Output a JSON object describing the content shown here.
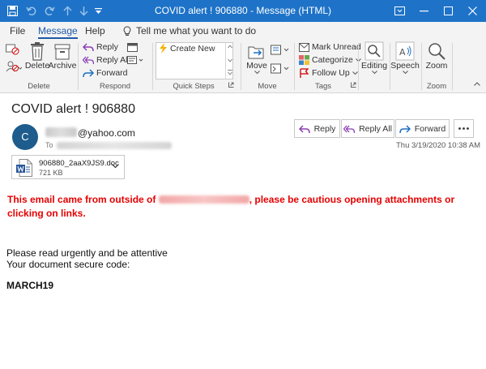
{
  "window": {
    "title": "COVID alert  ! 906880  -  Message (HTML)"
  },
  "tabs": [
    {
      "label": "File"
    },
    {
      "label": "Message"
    },
    {
      "label": "Help"
    }
  ],
  "tell_me": {
    "label": "Tell me what you want to do"
  },
  "ribbon": {
    "delete_group": {
      "label": "Delete",
      "delete": "Delete",
      "archive": "Archive"
    },
    "respond_group": {
      "label": "Respond",
      "reply": "Reply",
      "reply_all": "Reply All",
      "forward": "Forward"
    },
    "quick_steps_group": {
      "label": "Quick Steps",
      "create_new": "Create New"
    },
    "move_group": {
      "label": "Move",
      "move": "Move"
    },
    "tags_group": {
      "label": "Tags",
      "mark_unread": "Mark Unread",
      "categorize": "Categorize",
      "follow_up": "Follow Up"
    },
    "editing": "Editing",
    "speech": "Speech",
    "zoom_group": {
      "label": "Zoom",
      "zoom": "Zoom"
    }
  },
  "message": {
    "subject": "COVID alert  ! 906880",
    "avatar_initial": "C",
    "sender_domain": "@yahoo.com",
    "to_label": "To",
    "date": "Thu 3/19/2020 10:38 AM",
    "actions": {
      "reply": "Reply",
      "reply_all": "Reply All",
      "forward": "Forward"
    },
    "attachment": {
      "name": "906880_2aaX9JS9.doc",
      "size": "721 KB"
    },
    "warning": {
      "before": "This email came from outside of ",
      "after": ", please be cautious opening attachments or clicking on links."
    },
    "body_lines": [
      "Please read urgently and be attentive",
      "Your document secure code:"
    ],
    "code": "MARCH19"
  },
  "colors": {
    "title_bar": "#1e73c8",
    "warning_text": "#e60000",
    "avatar": "#1d5c8c",
    "accent": "#1e5aa8"
  }
}
